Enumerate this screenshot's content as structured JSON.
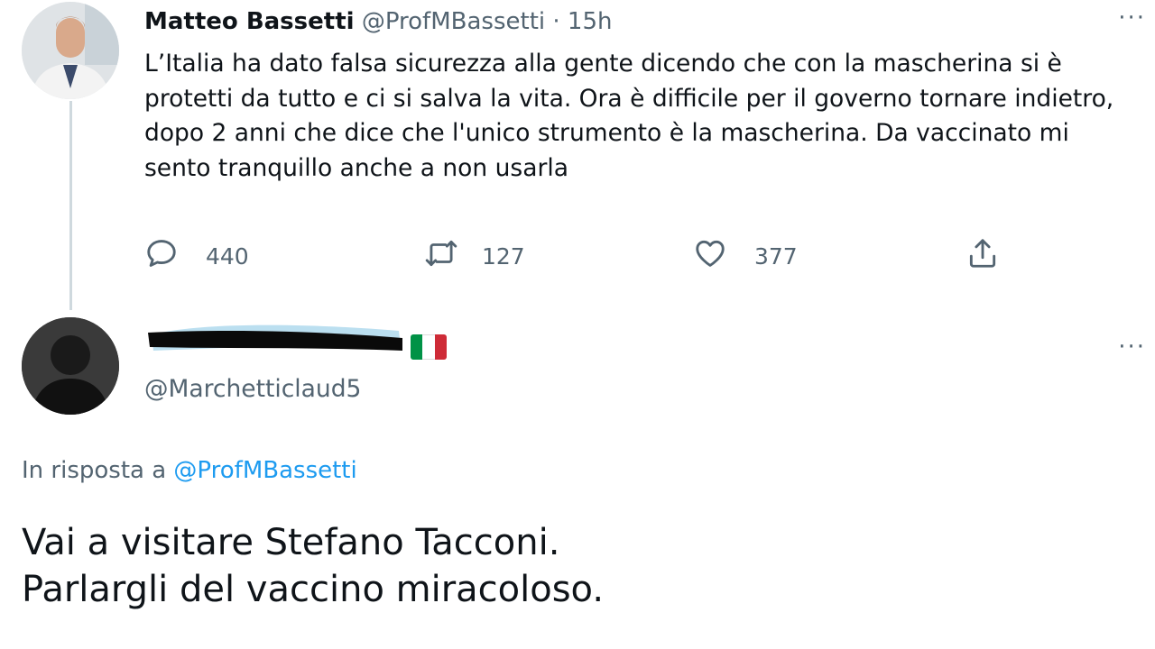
{
  "original_tweet": {
    "author_name": "Matteo Bassetti",
    "handle": "@ProfMBassetti",
    "separator": "·",
    "time": "15h",
    "text": "L’Italia ha dato falsa sicurezza alla gente dicendo che con la mascherina si è protetti da tutto e ci si salva la vita. Ora è difficile per il governo tornare indietro, dopo 2 anni che dice che l'unico strumento è la mascherina. Da vaccinato mi sento tranquillo anche a non usarla",
    "more_label": "···",
    "actions": {
      "replies": "440",
      "retweets": "127",
      "likes": "377"
    }
  },
  "reply": {
    "handle": "@Marchetticlaud5",
    "more_label": "···",
    "in_reply_prefix": "In risposta a",
    "in_reply_handle": "@ProfMBassetti",
    "text_line1": "Vai a visitare Stefano Tacconi.",
    "text_line2": "Parlargli del vaccino miracoloso."
  },
  "colors": {
    "text": "#0f1419",
    "muted": "#536471",
    "link": "#1d9bf0",
    "thread_line": "#cfd9de",
    "flag_green": "#009246",
    "flag_white": "#ffffff",
    "flag_red": "#ce2b37"
  },
  "icons": [
    "reply-icon",
    "retweet-icon",
    "like-icon",
    "share-icon",
    "more-icon",
    "italy-flag-icon"
  ]
}
